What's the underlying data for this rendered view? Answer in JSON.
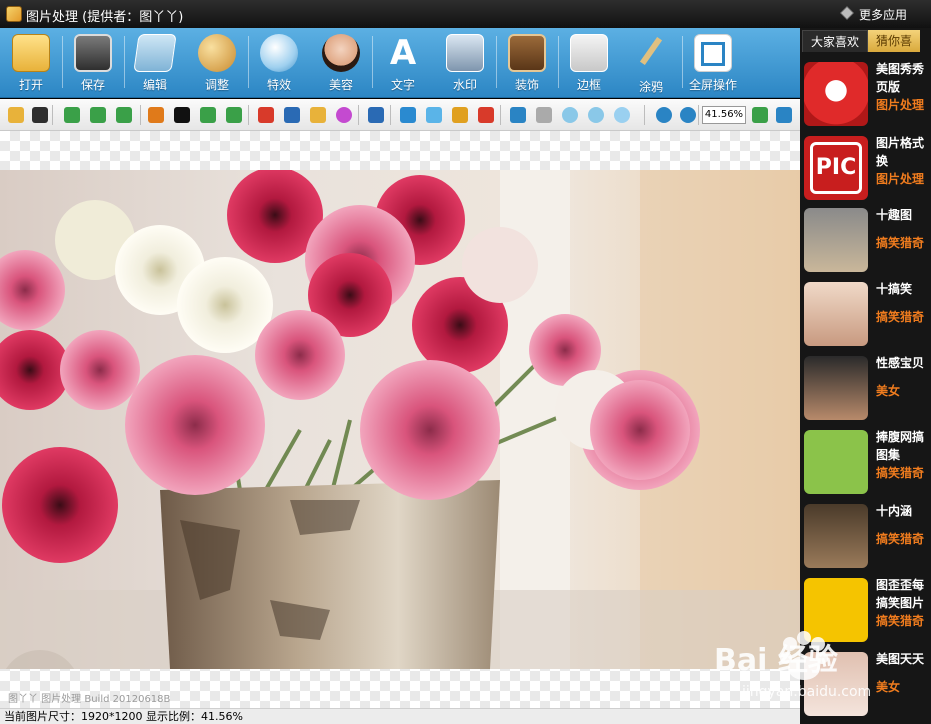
{
  "window": {
    "title": "图片处理 (提供者：图丫丫)",
    "more_apps": "更多应用"
  },
  "main_toolbar": [
    {
      "label": "打开",
      "icon": "folder-open-icon"
    },
    {
      "label": "保存",
      "icon": "floppy-disk-icon"
    },
    {
      "label": "编辑",
      "icon": "edit-image-icon"
    },
    {
      "label": "调整",
      "icon": "palette-icon"
    },
    {
      "label": "特效",
      "icon": "glass-orb-icon"
    },
    {
      "label": "美容",
      "icon": "woman-face-icon"
    },
    {
      "label": "文字",
      "icon": "letter-a-icon"
    },
    {
      "label": "水印",
      "icon": "stamp-icon"
    },
    {
      "label": "装饰",
      "icon": "frame-ornament-icon"
    },
    {
      "label": "边框",
      "icon": "border-pencil-icon"
    },
    {
      "label": "涂鸦",
      "icon": "paint-brush-icon"
    },
    {
      "label": "全屏操作",
      "icon": "fullscreen-icon"
    }
  ],
  "sub_toolbar": {
    "icons": [
      "open-small-icon",
      "save-small-icon",
      "undo-icon",
      "redo-icon",
      "refresh-icon",
      "crop-box-icon",
      "crop-icon",
      "rotate-icon",
      "arrow-right-icon",
      "layers-icon",
      "histogram-icon",
      "color-balance-icon",
      "color-wheel-icon",
      "text-a-icon",
      "levels-icon",
      "bulb-icon",
      "sparkle-icon",
      "frame-small-icon",
      "puzzle-icon",
      "face-mask-icon",
      "blur-drop-icon",
      "sharpen-drop-icon",
      "glow-icon",
      "zoom-in-icon",
      "zoom-out-icon",
      "fit-icon",
      "fullscreen-small-icon"
    ],
    "zoom_value": "41.56%"
  },
  "canvas": {
    "build_text": "图丫丫 图片处理 Build 20120618B"
  },
  "status": {
    "text": "当前图片尺寸：1920*1200 显示比例：41.56%"
  },
  "right_panel": {
    "tabs": [
      {
        "label": "大家喜欢",
        "active": true
      },
      {
        "label": "猜你喜",
        "active": false
      }
    ],
    "items": [
      {
        "name_lines": [
          "美图秀秀",
          "页版"
        ],
        "category": "图片处理",
        "thumb": "xiu-icon"
      },
      {
        "name_lines": [
          "图片格式",
          "换"
        ],
        "category": "图片处理",
        "thumb": "pic-icon"
      },
      {
        "name_lines": [
          "十趣图"
        ],
        "category": "搞笑猎奇",
        "thumb": "cats-thumb"
      },
      {
        "name_lines": [
          "十搞笑"
        ],
        "category": "搞笑猎奇",
        "thumb": "finger-thumb"
      },
      {
        "name_lines": [
          "性感宝贝"
        ],
        "category": "美女",
        "thumb": "woman-thumb"
      },
      {
        "name_lines": [
          "捧腹网搞",
          "图集"
        ],
        "category": "搞笑猎奇",
        "thumb": "cartoon-thumb"
      },
      {
        "name_lines": [
          "十内涵"
        ],
        "category": "搞笑猎奇",
        "thumb": "neihan-thumb"
      },
      {
        "name_lines": [
          "图歪歪每",
          "搞笑图片"
        ],
        "category": "搞笑猎奇",
        "thumb": "funny-face-thumb"
      },
      {
        "name_lines": [
          "美图天天"
        ],
        "category": "美女",
        "thumb": "beauty-thumb"
      }
    ]
  },
  "watermark": {
    "text": "Bai 经验",
    "sub": "jingyan.baidu.com"
  }
}
